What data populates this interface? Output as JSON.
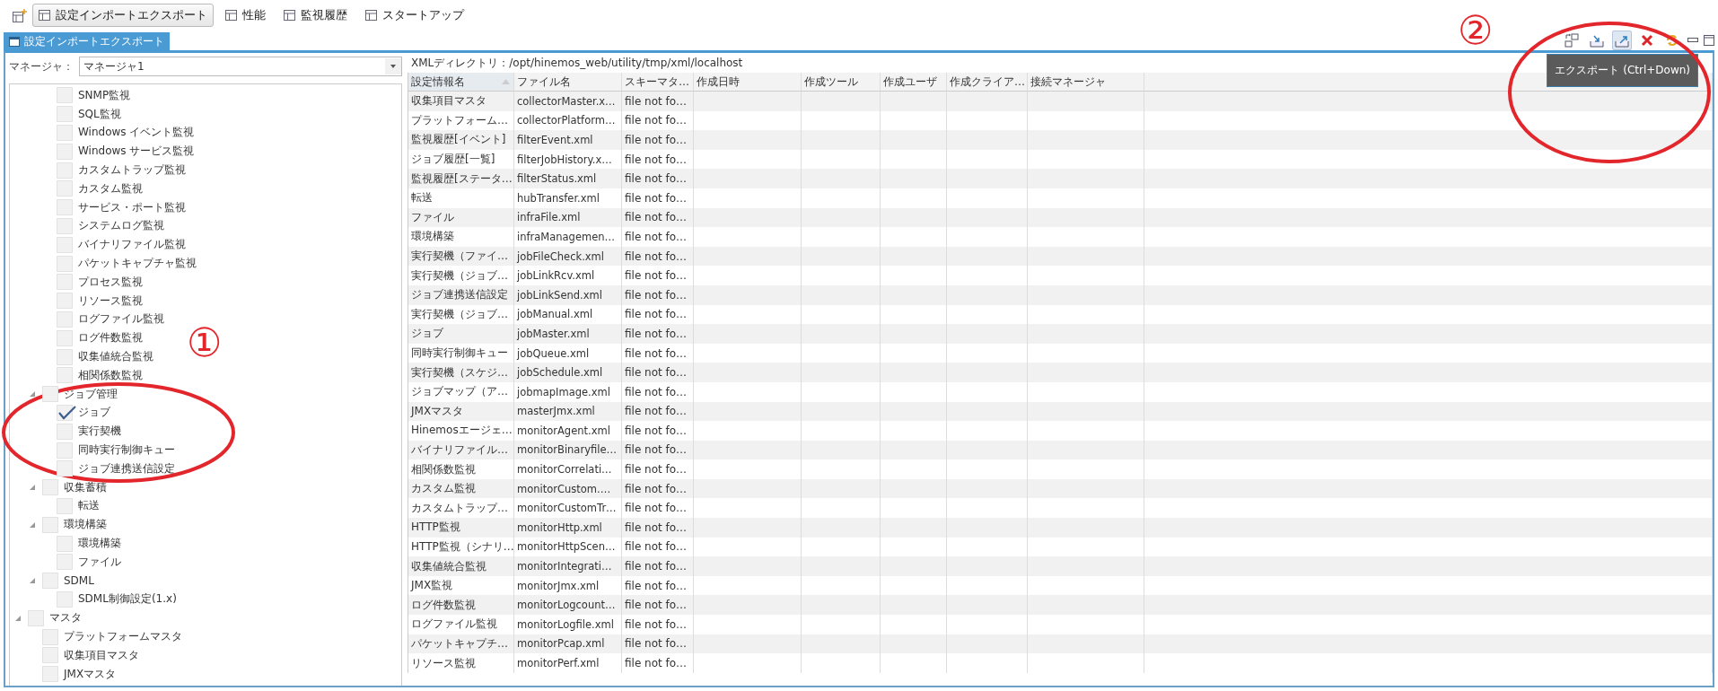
{
  "perspective_bar": {
    "tabs": [
      {
        "label": "設定インポートエクスポート",
        "selected": true
      },
      {
        "label": "性能",
        "selected": false
      },
      {
        "label": "監視履歴",
        "selected": false
      },
      {
        "label": "スタートアップ",
        "selected": false
      }
    ]
  },
  "view": {
    "tab": "設定インポートエクスポート",
    "toolbar": [
      {
        "kind": "swap",
        "hovered": false
      },
      {
        "kind": "import",
        "hovered": false
      },
      {
        "kind": "export",
        "hovered": true
      },
      {
        "kind": "delete",
        "hovered": false
      },
      {
        "kind": "refresh",
        "hovered": false
      }
    ],
    "tooltip": "エクスポート (Ctrl+Down)"
  },
  "manager": {
    "label": "マネージャ：",
    "value": "マネージャ1"
  },
  "tree": [
    {
      "children": [
        {
          "children": [
            {
              "label": "SNMP監視",
              "checked": false
            },
            {
              "label": "SQL監視",
              "checked": false
            },
            {
              "label": "Windows イベント監視",
              "checked": false
            },
            {
              "label": "Windows サービス監視",
              "checked": false
            },
            {
              "label": "カスタムトラップ監視",
              "checked": false
            },
            {
              "label": "カスタム監視",
              "checked": false
            },
            {
              "label": "サービス・ポート監視",
              "checked": false
            },
            {
              "label": "システムログ監視",
              "checked": false
            },
            {
              "label": "バイナリファイル監視",
              "checked": false
            },
            {
              "label": "パケットキャプチャ監視",
              "checked": false
            },
            {
              "label": "プロセス監視",
              "checked": false
            },
            {
              "label": "リソース監視",
              "checked": false
            },
            {
              "label": "ログファイル監視",
              "checked": false
            },
            {
              "label": "ログ件数監視",
              "checked": false
            },
            {
              "label": "収集値統合監視",
              "checked": false
            },
            {
              "label": "相関係数監視",
              "checked": false
            }
          ]
        },
        {
          "label": "ジョブ管理",
          "checked": false,
          "expanded": true,
          "children": [
            {
              "label": "ジョブ",
              "checked": true
            },
            {
              "label": "実行契機",
              "checked": false
            },
            {
              "label": "同時実行制御キュー",
              "checked": false
            },
            {
              "label": "ジョブ連携送信設定",
              "checked": false
            }
          ]
        },
        {
          "label": "収集蓄積",
          "checked": false,
          "expanded": true,
          "children": [
            {
              "label": "転送",
              "checked": false
            }
          ]
        },
        {
          "label": "環境構築",
          "checked": false,
          "expanded": true,
          "children": [
            {
              "label": "環境構築",
              "checked": false
            },
            {
              "label": "ファイル",
              "checked": false
            }
          ]
        },
        {
          "label": "SDML",
          "checked": false,
          "expanded": true,
          "children": [
            {
              "label": "SDML制御設定(1.x)",
              "checked": false
            }
          ]
        }
      ]
    },
    {
      "label": "マスタ",
      "checked": false,
      "expanded": true,
      "children": [
        {
          "label": "プラットフォームマスタ",
          "checked": false
        },
        {
          "label": "収集項目マスタ",
          "checked": false
        },
        {
          "label": "JMXマスタ",
          "checked": false
        }
      ]
    }
  ],
  "xml_directory": "XMLディレクトリ：/opt/hinemos_web/utility/tmp/xml/localhost",
  "table": {
    "columns": [
      {
        "label": "設定情報名",
        "sorted": true
      },
      {
        "label": "ファイル名",
        "sorted": false
      },
      {
        "label": "スキーマタ…",
        "sorted": false
      },
      {
        "label": "作成日時",
        "sorted": false
      },
      {
        "label": "作成ツール",
        "sorted": false
      },
      {
        "label": "作成ユーザ",
        "sorted": false
      },
      {
        "label": "作成クライア…",
        "sorted": false
      },
      {
        "label": "接続マネージャ",
        "sorted": false
      }
    ],
    "rows": [
      [
        "収集項目マスタ",
        "collectorMaster.x…",
        "file not fo…"
      ],
      [
        "プラットフォーム…",
        "collectorPlatform…",
        "file not fo…"
      ],
      [
        "監視履歴[イベント]",
        "filterEvent.xml",
        "file not fo…"
      ],
      [
        "ジョブ履歴[一覧]",
        "filterJobHistory.x…",
        "file not fo…"
      ],
      [
        "監視履歴[ステータ…",
        "filterStatus.xml",
        "file not fo…"
      ],
      [
        "転送",
        "hubTransfer.xml",
        "file not fo…"
      ],
      [
        "ファイル",
        "infraFile.xml",
        "file not fo…"
      ],
      [
        "環境構築",
        "infraManagemen…",
        "file not fo…"
      ],
      [
        "実行契機（ファイ…",
        "jobFileCheck.xml",
        "file not fo…"
      ],
      [
        "実行契機（ジョブ…",
        "jobLinkRcv.xml",
        "file not fo…"
      ],
      [
        "ジョブ連携送信設定",
        "jobLinkSend.xml",
        "file not fo…"
      ],
      [
        "実行契機（ジョブ…",
        "jobManual.xml",
        "file not fo…"
      ],
      [
        "ジョブ",
        "jobMaster.xml",
        "file not fo…"
      ],
      [
        "同時実行制御キュー",
        "jobQueue.xml",
        "file not fo…"
      ],
      [
        "実行契機（スケジ…",
        "jobSchedule.xml",
        "file not fo…"
      ],
      [
        "ジョブマップ（ア…",
        "jobmapImage.xml",
        "file not fo…"
      ],
      [
        "JMXマスタ",
        "masterJmx.xml",
        "file not fo…"
      ],
      [
        "Hinemosエージェ…",
        "monitorAgent.xml",
        "file not fo…"
      ],
      [
        "バイナリファイル…",
        "monitorBinaryfile…",
        "file not fo…"
      ],
      [
        "相関係数監視",
        "monitorCorrelati…",
        "file not fo…"
      ],
      [
        "カスタム監視",
        "monitorCustom.…",
        "file not fo…"
      ],
      [
        "カスタムトラップ…",
        "monitorCustomTr…",
        "file not fo…"
      ],
      [
        "HTTP監視",
        "monitorHttp.xml",
        "file not fo…"
      ],
      [
        "HTTP監視（シナリ…",
        "monitorHttpScen…",
        "file not fo…"
      ],
      [
        "収集値統合監視",
        "monitorIntegrati…",
        "file not fo…"
      ],
      [
        "JMX監視",
        "monitorJmx.xml",
        "file not fo…"
      ],
      [
        "ログ件数監視",
        "monitorLogcount…",
        "file not fo…"
      ],
      [
        "ログファイル監視",
        "monitorLogfile.xml",
        "file not fo…"
      ],
      [
        "パケットキャプチ…",
        "monitorPcap.xml",
        "file not fo…"
      ],
      [
        "リソース監視",
        "monitorPerf.xml",
        "file not fo…"
      ]
    ]
  },
  "annotations": [
    {
      "label": "①"
    },
    {
      "label": "②"
    }
  ]
}
